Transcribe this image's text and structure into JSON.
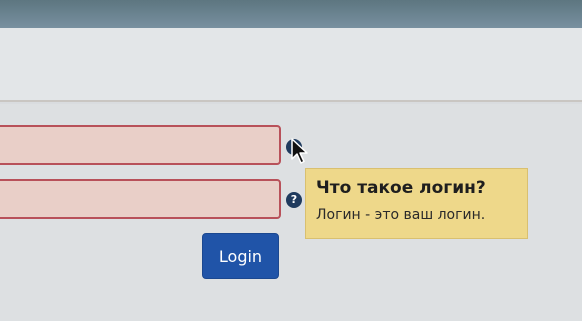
{
  "form": {
    "username": {
      "value": ""
    },
    "password": {
      "value": ""
    },
    "login_label": "Login"
  },
  "help_icons": {
    "glyph": "?",
    "icon": "question-circle-icon"
  },
  "tooltip": {
    "title": "Что такое логин?",
    "text": "Логин - это ваш логин."
  },
  "colors": {
    "error_border": "#b8515a",
    "error_fill": "#e9cfc8",
    "tooltip_bg": "#eed88a",
    "button_bg": "#2054a8"
  }
}
